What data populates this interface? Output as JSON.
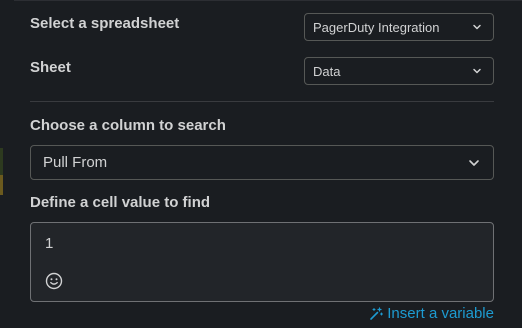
{
  "spreadsheet": {
    "label": "Select a spreadsheet",
    "selected": "PagerDuty Integration"
  },
  "sheet": {
    "label": "Sheet",
    "selected": "Data"
  },
  "column": {
    "label": "Choose a column to search",
    "selected": "Pull From"
  },
  "cell_value": {
    "label": "Define a cell value to find",
    "value": "1"
  },
  "insert_variable": {
    "label": "Insert a variable"
  },
  "colors": {
    "background": "#1a1d21",
    "link": "#1d9bd1",
    "border": "#565856"
  },
  "icons": {
    "dropdown": "chevron-down-icon",
    "emoji": "emoji-icon",
    "variable": "magic-wand-icon"
  }
}
